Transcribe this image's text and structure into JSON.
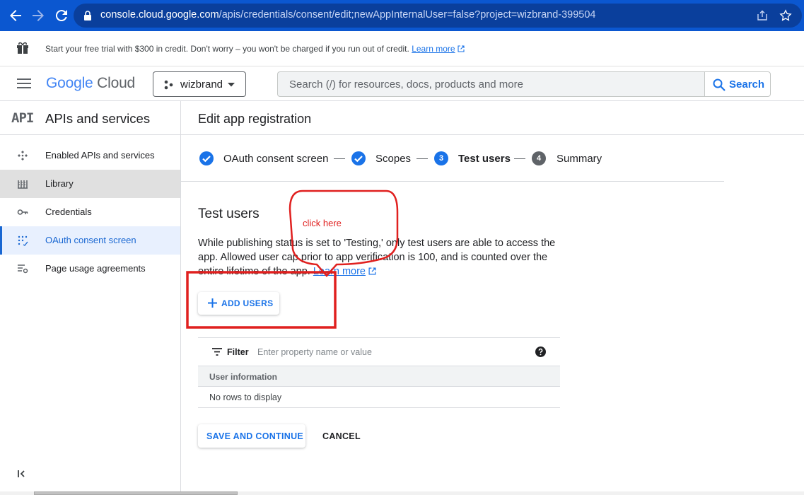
{
  "browser": {
    "url_host": "console.cloud.google.com",
    "url_path": "/apis/credentials/consent/edit;newAppInternalUser=false?project=wizbrand-399504",
    "icons": [
      "back-arrow-icon",
      "forward-arrow-icon",
      "reload-icon",
      "lock-icon",
      "share-icon",
      "star-icon"
    ]
  },
  "promo": {
    "text": "Start your free trial with $300 in credit. Don't worry – you won't be charged if you run out of credit.",
    "link": "Learn more"
  },
  "header": {
    "logo_google": "Google",
    "logo_cloud": "Cloud",
    "project": "wizbrand",
    "search_placeholder": "Search (/) for resources, docs, products and more",
    "search_button": "Search"
  },
  "sidebar": {
    "badge": "API",
    "title": "APIs and services",
    "items": [
      {
        "label": "Enabled APIs and services",
        "icon": "enabled-apis-icon"
      },
      {
        "label": "Library",
        "icon": "library-icon"
      },
      {
        "label": "Credentials",
        "icon": "key-icon"
      },
      {
        "label": "OAuth consent screen",
        "icon": "consent-screen-icon"
      },
      {
        "label": "Page usage agreements",
        "icon": "settings-list-icon"
      }
    ]
  },
  "main": {
    "page_title": "Edit app registration",
    "steps": [
      {
        "label": "OAuth consent screen",
        "state": "done"
      },
      {
        "label": "Scopes",
        "state": "done"
      },
      {
        "label": "Test users",
        "number": "3",
        "state": "current"
      },
      {
        "label": "Summary",
        "number": "4",
        "state": "pending"
      }
    ],
    "section_title": "Test users",
    "description": "While publishing status is set to 'Testing,' only test users are able to access the app. Allowed user cap prior to app verification is 100, and is counted over the entire lifetime of the app.",
    "learn_more": "Learn more",
    "add_users": "ADD USERS",
    "filter_label": "Filter",
    "filter_placeholder": "Enter property name or value",
    "column_header": "User information",
    "empty_text": "No rows to display",
    "save_button": "SAVE AND CONTINUE",
    "cancel_button": "CANCEL"
  },
  "annotation": {
    "text": "click here",
    "color": "#e0201f"
  },
  "colors": {
    "accent": "#1a73e8",
    "browser_bar": "#0b57d0",
    "active_nav_bg": "#e8f0fe"
  }
}
